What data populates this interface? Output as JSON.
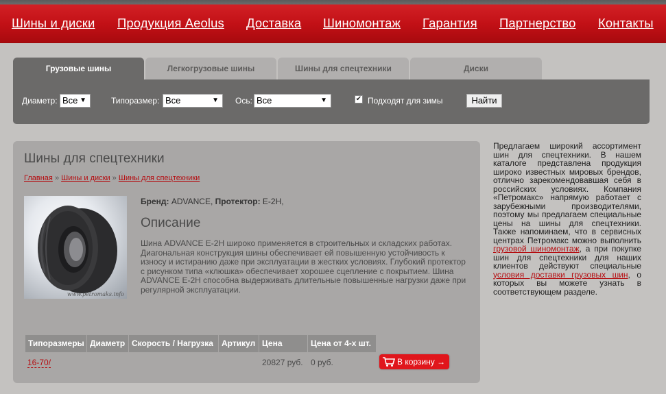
{
  "nav": {
    "items": [
      "Шины и диски",
      "Продукция Aeolus",
      "Доставка",
      "Шиномонтаж",
      "Гарантия",
      "Партнерство",
      "Контакты"
    ]
  },
  "tabs": [
    {
      "label": "Грузовые шины",
      "active": true
    },
    {
      "label": "Легкогрузовые шины",
      "active": false
    },
    {
      "label": "Шины для спецтехники",
      "active": false
    },
    {
      "label": "Диски",
      "active": false
    }
  ],
  "filters": {
    "diameter_label": "Диаметр:",
    "diameter_value": "Все",
    "size_label": "Типоразмер:",
    "size_value": "Все",
    "axis_label": "Ось:",
    "axis_value": "Все",
    "winter_label": "Подходят для зимы",
    "winter_checked": true,
    "search_button": "Найти"
  },
  "main": {
    "title": "Шины для спецтехники",
    "breadcrumb": [
      "Главная",
      "Шины и диски",
      "Шины для спецтехники"
    ],
    "breadcrumb_sep": "»",
    "brand_label": "Бренд:",
    "brand_value": "ADVANCE,",
    "tread_label": "Протектор:",
    "tread_value": "E-2H,",
    "desc_heading": "Описание",
    "description": "Шина ADVANCE E-2H широко применяется в строительных и складских работах. Диагональная конструкция шины обеспечивает ей повышенную устойчивость к износу и истиранию даже при эксплуатации в жестких условиях. Глубокий протектор с рисунком типа «клюшка» обеспечивает хорошее сцепление с покрытием. Шина ADVANCE E-2H способна выдерживать длительные повышенные нагрузки даже при регулярной эксплуатации.",
    "image_watermark": "www.petromaks.info"
  },
  "table": {
    "headers": [
      "Типоразмеры",
      "Диаметр",
      "Скорость / Нагрузка",
      "Артикул",
      "Цена",
      "Цена от 4-х шт."
    ],
    "row": {
      "size": "16-70/",
      "price": "20827 руб.",
      "price4": "0 руб."
    },
    "cart_button": "В корзину →"
  },
  "sidebar": {
    "p1": "Предлагаем широкий ассортимент шин для спецтехники. В нашем каталоге представлена продукция широко известных мировых брендов, отлично зарекомендовавшая себя в российских условиях. Компания «Петромакс» напрямую работает с зарубежными производителями, поэтому мы предлагаем специальные цены на шины для спецтехники. Также напоминаем, что в сервисных центрах Петромакс можно выполнить",
    "link1": "грузовой шиномонтаж",
    "p2": ", а при покупке шин для спецтехники для наших клиентов действуют специальные",
    "link2": "условия доставки грузовых шин",
    "p3": ", о которых вы можете узнать в соответствующем разделе."
  },
  "colors": {
    "brand_red": "#c21016",
    "tab_active": "#6b6a69",
    "link": "#b50c10"
  }
}
